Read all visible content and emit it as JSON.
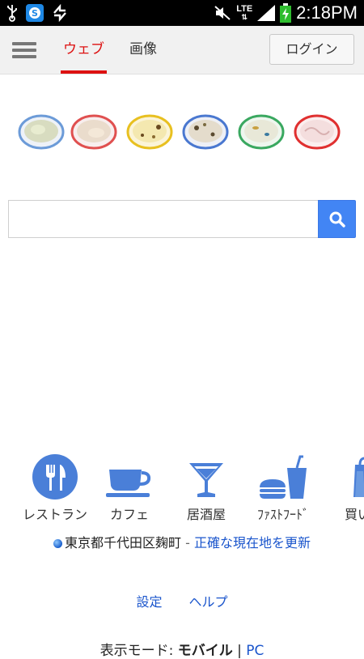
{
  "status_bar": {
    "time": "2:18PM",
    "network": "LTE",
    "icons": [
      "usb-icon",
      "skype-icon",
      "sync-icon",
      "mute-icon",
      "signal-icon",
      "battery-charging-icon"
    ]
  },
  "header": {
    "tabs": [
      {
        "label": "ウェブ",
        "active": true
      },
      {
        "label": "画像",
        "active": false
      }
    ],
    "login_label": "ログイン",
    "accent_color": "#dd1111"
  },
  "logo": {
    "dishes": [
      "#6c9bd8",
      "#e05050",
      "#e8c020",
      "#4a78d0",
      "#3aa860",
      "#e03030"
    ]
  },
  "search": {
    "value": "",
    "button_color": "#4285f4"
  },
  "categories": [
    {
      "label": "レストラン",
      "icon": "fork-knife-icon"
    },
    {
      "label": "カフェ",
      "icon": "coffee-cup-icon"
    },
    {
      "label": "居酒屋",
      "icon": "cocktail-glass-icon"
    },
    {
      "label": "ﾌｧｽﾄﾌｰﾄﾞ",
      "icon": "burger-drink-icon"
    },
    {
      "label": "買い",
      "icon": "shopping-bag-icon"
    }
  ],
  "location": {
    "place": "東京都千代田区麹町",
    "separator": " - ",
    "update_link": "正確な現在地を更新"
  },
  "footer": {
    "settings": "設定",
    "help": "ヘルプ"
  },
  "display_mode": {
    "prefix": "表示モード: ",
    "mobile": "モバイル",
    "separator": " | ",
    "pc": "PC"
  }
}
